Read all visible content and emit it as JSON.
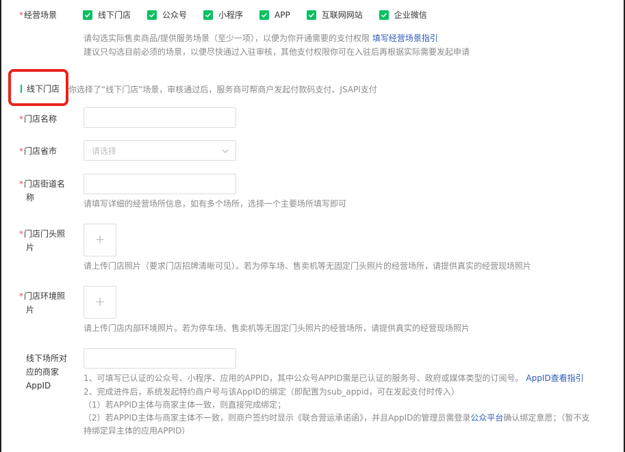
{
  "scenes": {
    "label": "经营场景",
    "options": [
      "线下门店",
      "公众号",
      "小程序",
      "APP",
      "互联网网站",
      "企业微信"
    ],
    "hint_line1": "请勾选实际售卖商品/提供服务场景（至少一项），以便为你开通需要的支付权限",
    "hint_link": "填写经营场景指引",
    "hint_line2": "建议只勾选目前必须的场景，以便尽快通过入驻审核，其他支付权限你可在入驻后再根据实际需要发起申请"
  },
  "section": {
    "title": "线下门店",
    "note": "你选择了“线下门店”场景，审核通过后，服务商可帮商户发起付款码支付、JSAPI支付"
  },
  "store_name": {
    "label": "门店名称"
  },
  "store_city": {
    "label": "门店省市",
    "placeholder": "请选择"
  },
  "store_street": {
    "label_line1": "门店街道名",
    "label_line2": "称",
    "hint": "请填写详细的经营场所信息，如有多个场所，选择一个主要场所填写即可"
  },
  "store_front_photo": {
    "label_line1": "门店门头照",
    "label_line2": "片",
    "upload_symbol": "+",
    "hint": "请上传门店照片（要求门店招牌清晰可见）。若为停车场、售卖机等无固定门头照片的经营场所，请提供真实的经营现场照片"
  },
  "store_env_photo": {
    "label_line1": "门店环境照",
    "label_line2": "片",
    "upload_symbol": "+",
    "hint": "请上传门店内部环境照片。若为停车场、售卖机等无固定门头照片的经营场所，请提供真实的经营现场照片"
  },
  "appid": {
    "label_line1": "线下场所对",
    "label_line2": "应的商家",
    "label_line3": "AppID",
    "line1": "1、可填写已认证的公众号、小程序、应用的APPID，其中公众号APPID需是已认证的服务号、政府或媒体类型的订阅号。",
    "line1_link": "AppID查看指引",
    "line2": "2、完成进件后，系统发起特约商户号与该AppID的绑定（即配置为sub_appid，可在发起支付时传入）",
    "line3": "（1）若APPID主体与商家主体一致，则直接完成绑定；",
    "line4_a": "（2）若APPID主体与商家主体不一致，则商户签约时显示《联合营运承诺函》，并且AppID的管理员需登录",
    "line4_link": "公众平台",
    "line4_b": "确认绑定意愿；（暂不支",
    "line5": "持绑定异主体的应用APPID）"
  },
  "colors": {
    "accent": "#07c160",
    "required": "#e34d59",
    "link": "#2e5ab8",
    "highlight": "#e8231c"
  }
}
